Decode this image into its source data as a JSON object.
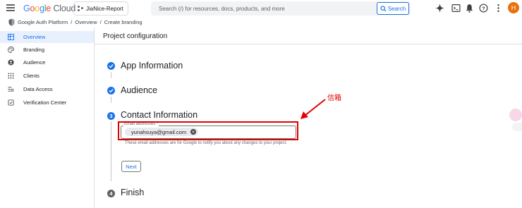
{
  "topbar": {
    "logo": {
      "google": "Google",
      "cloud": "Cloud"
    },
    "project_name": "JiaNice-Report",
    "search_placeholder": "Search (/) for resources, docs, products, and more",
    "search_button": "Search",
    "avatar_letter": "H"
  },
  "breadcrumb": {
    "items": [
      "Google Auth Platform",
      "/",
      "Overview",
      "/",
      "Create branding"
    ]
  },
  "sidebar": {
    "items": [
      {
        "label": "Overview",
        "icon": "grid-icon",
        "active": true
      },
      {
        "label": "Branding",
        "icon": "palette-icon"
      },
      {
        "label": "Audience",
        "icon": "person-icon"
      },
      {
        "label": "Clients",
        "icon": "apps-icon"
      },
      {
        "label": "Data Access",
        "icon": "data-access-icon"
      },
      {
        "label": "Verification Center",
        "icon": "verified-icon"
      }
    ]
  },
  "main": {
    "title": "Project configuration",
    "steps": [
      {
        "number": "",
        "title": "App Information",
        "state": "done"
      },
      {
        "number": "",
        "title": "Audience",
        "state": "done"
      },
      {
        "number": "3",
        "title": "Contact Information",
        "state": "current"
      },
      {
        "number": "4",
        "title": "Finish",
        "state": "pending"
      }
    ],
    "email_field": {
      "label": "Email addresses *",
      "chip": "yunahsuya@gmail.com",
      "help": "These email addresses are for Google to notify you about any changes to your project."
    },
    "next_button": "Next"
  },
  "annotation": {
    "label": "信箱",
    "color": "#e00000"
  },
  "colors": {
    "accent": "#1a73e8",
    "active_bg": "#e8f0fe",
    "avatar": "#e8710a"
  }
}
